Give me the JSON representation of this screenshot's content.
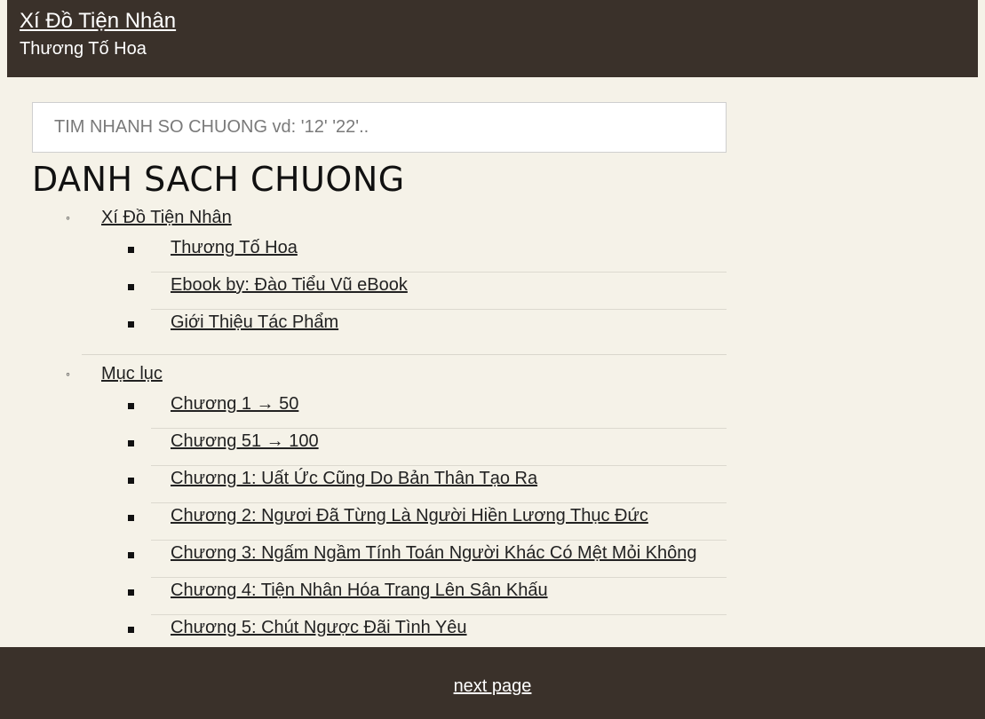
{
  "header": {
    "title": "Xí Đồ Tiện Nhân",
    "subtitle": "Thương Tố Hoa"
  },
  "search": {
    "placeholder": "TIM NHANH SO CHUONG vd: '12' '22'.."
  },
  "list_title": "DANH SACH CHUONG",
  "sections": [
    {
      "label": "Xí Đồ Tiện Nhân",
      "items": [
        {
          "label": "Thương Tố Hoa"
        },
        {
          "label": "Ebook by: Đào Tiểu Vũ eBook"
        },
        {
          "label": "Giới Thiệu Tác Phẩm"
        }
      ]
    },
    {
      "label": "Mục lục",
      "items": [
        {
          "label": "Chương 1 → 50"
        },
        {
          "label": "Chương 51 → 100"
        },
        {
          "label": "Chương 1: Uất Ức Cũng Do Bản Thân Tạo Ra"
        },
        {
          "label": "Chương 2: Ngươi Đã Từng Là Người Hiền Lương Thục Đức"
        },
        {
          "label": "Chương 3: Ngấm Ngầm Tính Toán Người Khác Có Mệt Mỏi Không"
        },
        {
          "label": "Chương 4: Tiện Nhân Hóa Trang Lên Sân Khấu"
        },
        {
          "label": "Chương 5: Chút Ngược Đãi Tình Yêu"
        }
      ]
    }
  ],
  "footer": {
    "next_label": "next page"
  }
}
